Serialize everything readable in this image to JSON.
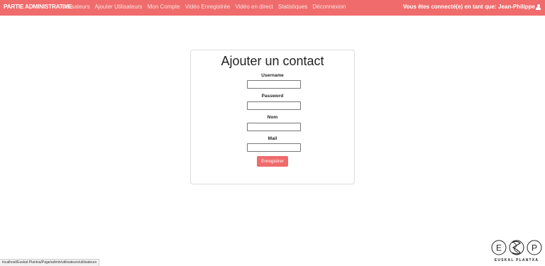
{
  "navbar": {
    "brand": "PARTIE ADMINISTRATIVE",
    "links": [
      {
        "label": "Utilisateurs"
      },
      {
        "label": "Ajouter Utilisateurs"
      },
      {
        "label": "Mon Compte"
      },
      {
        "label": "Vidéo Enregistrée"
      },
      {
        "label": "Vidéo en direct"
      },
      {
        "label": "Statistiques"
      },
      {
        "label": "Déconnexion"
      }
    ],
    "user_text": "Vous êtes connecté(e) en tant que: Jean-Philippe",
    "user_icon": "user-icon"
  },
  "form": {
    "title": "Ajouter un contact",
    "fields": [
      {
        "label": "Username",
        "value": ""
      },
      {
        "label": "Password",
        "value": ""
      },
      {
        "label": "Nom",
        "value": ""
      },
      {
        "label": "Mail",
        "value": ""
      }
    ],
    "submit_label": "Enregistrer"
  },
  "statusbar": {
    "url": "localhost/Euskal-Plantxa/Page/admin/utilisateurs/utilisateurs"
  },
  "logo": {
    "text": "EUSKAL PLANTXA"
  },
  "colors": {
    "accent": "#f06b6b",
    "background": "#ffffff"
  }
}
